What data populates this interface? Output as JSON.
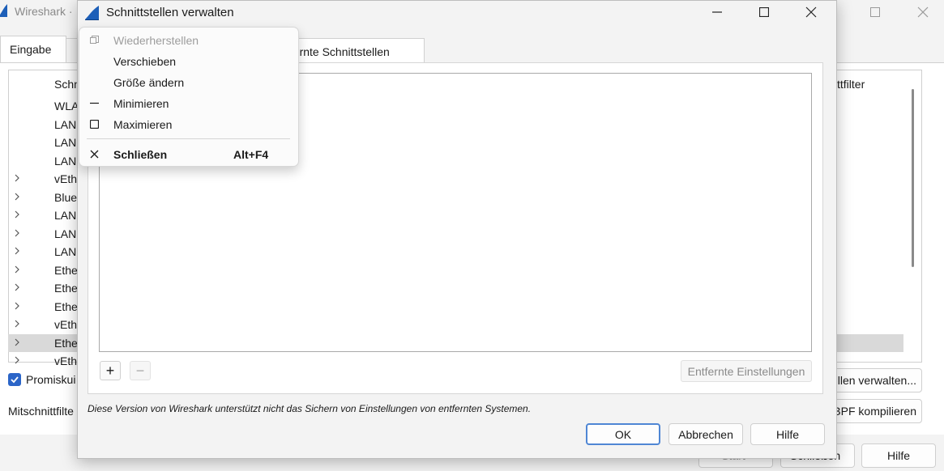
{
  "background_window": {
    "title": "Wireshark ·",
    "tab_label": "Eingabe",
    "column_header": "Schn",
    "column_header_right": "ttfilter",
    "rows": [
      {
        "label": "WLA",
        "expandable": false,
        "selected": false
      },
      {
        "label": "LAN",
        "expandable": false,
        "selected": false
      },
      {
        "label": "LAN",
        "expandable": false,
        "selected": false
      },
      {
        "label": "LAN",
        "expandable": false,
        "selected": false
      },
      {
        "label": "vEth",
        "expandable": true,
        "selected": false
      },
      {
        "label": "Blue",
        "expandable": true,
        "selected": false
      },
      {
        "label": "LAN",
        "expandable": true,
        "selected": false
      },
      {
        "label": "LAN",
        "expandable": true,
        "selected": false
      },
      {
        "label": "LAN",
        "expandable": true,
        "selected": false
      },
      {
        "label": "Ethe",
        "expandable": true,
        "selected": false
      },
      {
        "label": "Ethe",
        "expandable": true,
        "selected": false
      },
      {
        "label": "Ethe",
        "expandable": true,
        "selected": false
      },
      {
        "label": "vEth",
        "expandable": true,
        "selected": false
      },
      {
        "label": "Ethe",
        "expandable": true,
        "selected": true
      },
      {
        "label": "vEth",
        "expandable": true,
        "selected": false
      }
    ],
    "promiscuous_label": "Promiskui",
    "capture_filter_label": "Mitschnittfilte",
    "manage_button": "llen verwalten...",
    "bpf_button": "BPF kompilieren",
    "start_button": "Start",
    "close_button": "Schließen",
    "help_button": "Hilfe"
  },
  "dialog": {
    "title": "Schnittstellen verwalten",
    "tab_remote": "tfernte Schnittstellen",
    "add_button": "+",
    "remove_button": "−",
    "remote_settings_button": "Entfernte Einstellungen",
    "note": "Diese Version von Wireshark unterstützt nicht das Sichern von Einstellungen von entfernten Systemen.",
    "ok_button": "OK",
    "cancel_button": "Abbrechen",
    "help_button": "Hilfe"
  },
  "system_menu": {
    "items": [
      {
        "label": "Wiederherstellen",
        "icon": "restore-icon",
        "enabled": false
      },
      {
        "label": "Verschieben",
        "icon": "",
        "enabled": true
      },
      {
        "label": "Größe ändern",
        "icon": "",
        "enabled": true
      },
      {
        "label": "Minimieren",
        "icon": "minimize-icon",
        "enabled": true
      },
      {
        "label": "Maximieren",
        "icon": "maximize-icon",
        "enabled": true
      },
      {
        "label": "Schließen",
        "icon": "close-icon",
        "enabled": true,
        "shortcut": "Alt+F4"
      }
    ]
  },
  "colors": {
    "accent": "#2b65c8",
    "selection": "#d9d9d9",
    "default_button_border": "#4f86d4"
  }
}
